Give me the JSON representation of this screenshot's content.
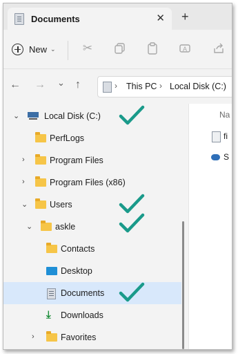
{
  "tab": {
    "title": "Documents",
    "close": "✕",
    "new_tab": "+"
  },
  "commandbar": {
    "new_label": "New",
    "new_chevron": "⌄"
  },
  "nav": {
    "back": "←",
    "forward": "→",
    "recent": "⌄",
    "up": "↑"
  },
  "address": {
    "crumb_sep": "›",
    "crumbs": [
      "This PC",
      "Local Disk (C:)"
    ]
  },
  "tree": {
    "items": [
      {
        "label": "Local Disk (C:)",
        "expander": "⌄"
      },
      {
        "label": "PerfLogs"
      },
      {
        "label": "Program Files",
        "expander": "›"
      },
      {
        "label": "Program Files (x86)",
        "expander": "›"
      },
      {
        "label": "Users",
        "expander": "⌄"
      },
      {
        "label": "askle",
        "expander": "⌄"
      },
      {
        "label": "Contacts"
      },
      {
        "label": "Desktop"
      },
      {
        "label": "Documents"
      },
      {
        "label": "Downloads"
      },
      {
        "label": "Favorites",
        "expander": "›"
      }
    ]
  },
  "content": {
    "header": "Na",
    "item1": "fi",
    "item2": "S"
  },
  "colors": {
    "checkmark": "#1a9a8a",
    "selection": "#d8e8fb",
    "folder": "#f6c548"
  }
}
